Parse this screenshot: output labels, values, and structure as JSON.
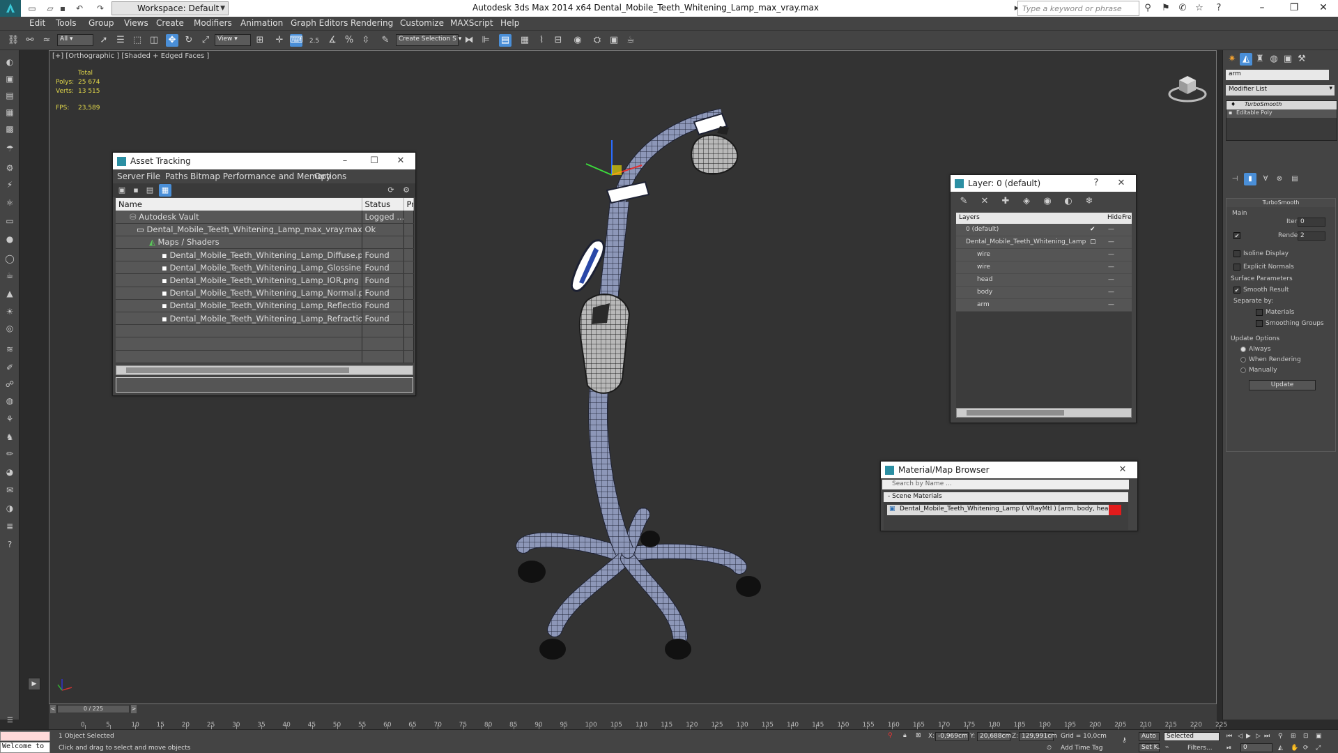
{
  "app": {
    "title": "Autodesk 3ds Max  2014 x64      Dental_Mobile_Teeth_Whitening_Lamp_max_vray.max",
    "workspace": "Workspace: Default",
    "search_placeholder": "Type a keyword or phrase"
  },
  "menu": [
    "Edit",
    "Tools",
    "Group",
    "Views",
    "Create",
    "Modifiers",
    "Animation",
    "Graph Editors",
    "Rendering",
    "Customize",
    "MAXScript",
    "Help"
  ],
  "toolbar": {
    "selection_filter": "All",
    "ref_coord": "View",
    "snap_value": "2.5",
    "named_selection": "Create Selection S"
  },
  "viewport": {
    "label": "[+] [Orthographic ] [Shaded + Edged Faces ]",
    "stats": {
      "total_label": "Total",
      "polys_label": "Polys:",
      "polys": "25 674",
      "verts_label": "Verts:",
      "verts": "13 515",
      "fps_label": "FPS:",
      "fps": "23,589"
    }
  },
  "asset_tracking": {
    "title": "Asset Tracking",
    "menu": [
      "Server",
      "File",
      "Paths",
      "Bitmap Performance and Memory",
      "Options"
    ],
    "columns": [
      "Name",
      "Status",
      "Pr"
    ],
    "rows": [
      {
        "name": "Autodesk Vault",
        "status": "Logged ..."
      },
      {
        "name": "Dental_Mobile_Teeth_Whitening_Lamp_max_vray.max",
        "status": "Ok"
      },
      {
        "name": "Maps / Shaders",
        "status": ""
      },
      {
        "name": "Dental_Mobile_Teeth_Whitening_Lamp_Diffuse.png",
        "status": "Found"
      },
      {
        "name": "Dental_Mobile_Teeth_Whitening_Lamp_Glossiness.png",
        "status": "Found"
      },
      {
        "name": "Dental_Mobile_Teeth_Whitening_Lamp_IOR.png",
        "status": "Found"
      },
      {
        "name": "Dental_Mobile_Teeth_Whitening_Lamp_Normal.png",
        "status": "Found"
      },
      {
        "name": "Dental_Mobile_Teeth_Whitening_Lamp_Reflection.png",
        "status": "Found"
      },
      {
        "name": "Dental_Mobile_Teeth_Whitening_Lamp_Refraction.png",
        "status": "Found"
      }
    ]
  },
  "layers": {
    "title": "Layer: 0 (default)",
    "col_layers": "Layers",
    "col_hide": "Hide",
    "col_freeze": "Fre",
    "items": [
      "0 (default)",
      "Dental_Mobile_Teeth_Whitening_Lamp",
      "wire",
      "wire",
      "head",
      "body",
      "arm"
    ]
  },
  "material_browser": {
    "title": "Material/Map Browser",
    "search_placeholder": "Search by Name ...",
    "group": "- Scene Materials",
    "material": "Dental_Mobile_Teeth_Whitening_Lamp  ( VRayMtl ) [arm, body, head, wire, wire]"
  },
  "command_panel": {
    "object_name": "arm",
    "modifier_list": "Modifier List",
    "stack": [
      "TurboSmooth",
      "Editable Poly"
    ],
    "rollout_title": "TurboSmooth",
    "main_label": "Main",
    "iterations_label": "Iterations:",
    "iterations": "0",
    "render_iters_label": "Render Iters:",
    "render_iters": "2",
    "isoline": "Isoline Display",
    "explicit_normals": "Explicit Normals",
    "surface_params": "Surface Parameters",
    "smooth_result": "Smooth Result",
    "separate_by": "Separate by:",
    "materials": "Materials",
    "smoothing_groups": "Smoothing Groups",
    "update_options": "Update Options",
    "always": "Always",
    "when_rendering": "When Rendering",
    "manually": "Manually",
    "update_button": "Update"
  },
  "timeline": {
    "frame": "0 / 225",
    "labels": [
      "0",
      "5",
      "10",
      "15",
      "20",
      "25",
      "30",
      "35",
      "40",
      "45",
      "50",
      "55",
      "60",
      "65",
      "70",
      "75",
      "80",
      "85",
      "90",
      "95",
      "100",
      "105",
      "110",
      "115",
      "120",
      "125",
      "130",
      "135",
      "140",
      "145",
      "150",
      "155",
      "160",
      "165",
      "170",
      "175",
      "180",
      "185",
      "190",
      "195",
      "200",
      "205",
      "210",
      "215",
      "220",
      "225"
    ]
  },
  "status": {
    "script_listener": "Welcome to",
    "selection": "1 Object Selected",
    "prompt": "Click and drag to select and move objects",
    "x": "-0,969cm",
    "y": "20,688cm",
    "z": "129,991cm",
    "grid": "Grid = 10,0cm",
    "add_time_tag": "Add Time Tag",
    "auto": "Auto",
    "selected": "Selected",
    "setk": "Set K.",
    "filters": "Filters...",
    "frame_field": "0"
  }
}
